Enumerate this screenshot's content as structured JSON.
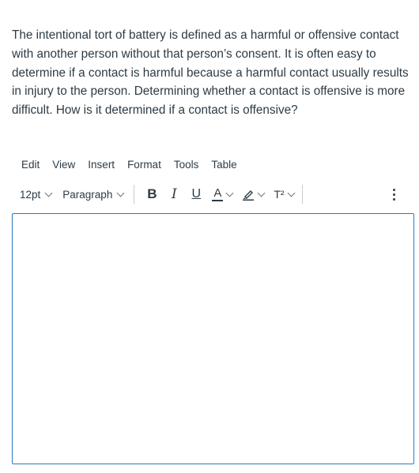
{
  "question": {
    "text": "The intentional tort of battery is defined as a harmful or offensive contact with another person without that person’s consent. It is often easy to determine if a contact is harmful because a harmful contact usually results in injury to the person. Determining whether a contact is offensive is more difficult. How is it determined if a contact is offensive?"
  },
  "menubar": {
    "items": [
      "Edit",
      "View",
      "Insert",
      "Format",
      "Tools",
      "Table"
    ]
  },
  "toolbar": {
    "font_size": "12pt",
    "block_format": "Paragraph",
    "bold_label": "B",
    "italic_label": "I",
    "underline_label": "U",
    "text_color_label": "A",
    "superscript_label": "T²"
  },
  "editor": {
    "value": ""
  },
  "colors": {
    "text": "#2d3b45",
    "editor_border": "#2b7abc",
    "separator": "#c7cdd1"
  }
}
